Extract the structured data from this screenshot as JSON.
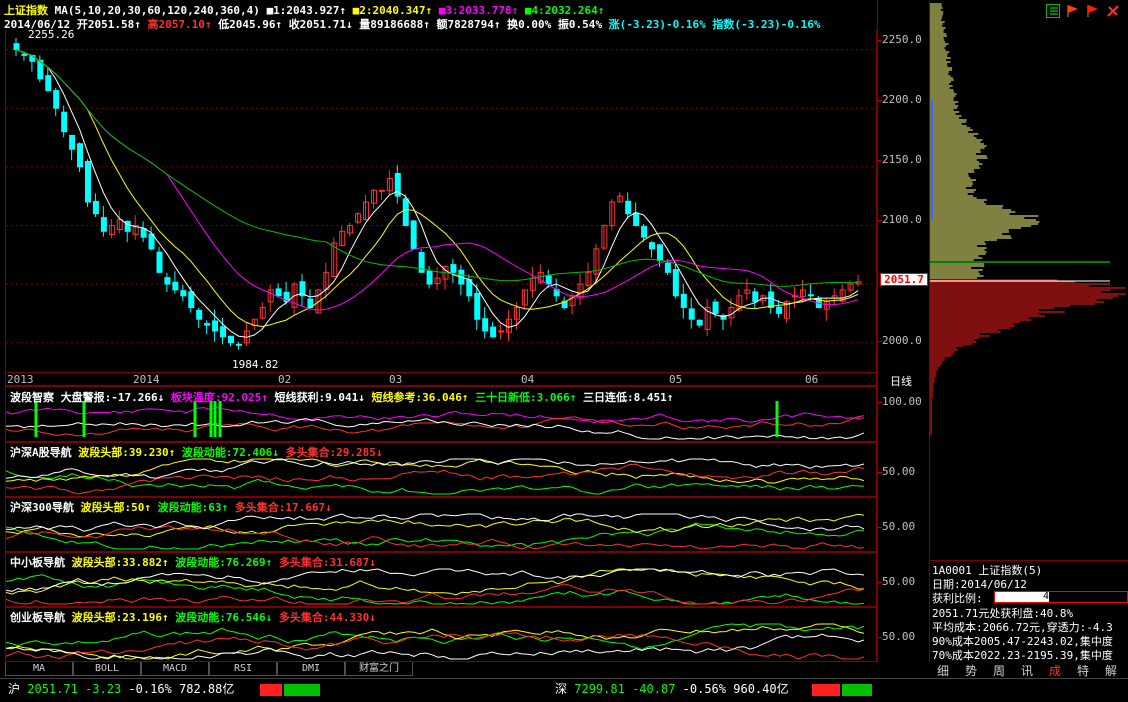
{
  "header": {
    "index_name": "上证指数",
    "ma_params": "MA(5,10,20,30,60,120,240,360,4)",
    "m1": "■1:2043.927↑",
    "m2": "■2:2040.347↑",
    "m3": "■3:2033.778↑",
    "m4": "■4:2032.264↑",
    "date": "2014/06/12",
    "open": "开2051.58↑",
    "high": "高2057.10↑",
    "low": "低2045.96↑",
    "close": "收2051.71↓",
    "volume": "量89186688↑",
    "amount": "额7828794↑",
    "turnover": "换0.00%",
    "amplitude": "振0.54%",
    "change": "涨(-3.23)-0.16%",
    "index_change": "指数(-3.23)-0.16%"
  },
  "toolbar_icons": [
    "grid-icon",
    "flag-icon",
    "flag-icon",
    "tools-icon"
  ],
  "main_chart": {
    "y_ticks": [
      "2250.0",
      "2200.0",
      "2150.0",
      "2100.0",
      "2050.0",
      "2000.0"
    ],
    "price_tag": "2051.7",
    "high_label": "2255.26",
    "low_label": "1984.82",
    "x_labels": [
      "2013",
      "2014",
      "02",
      "03",
      "04",
      "05",
      "06"
    ],
    "period": "日线"
  },
  "chart_data": {
    "type": "candlestick",
    "ylim": [
      1975,
      2265
    ],
    "values": [
      2250,
      2245,
      2240,
      2225,
      2215,
      2200,
      2180,
      2165,
      2150,
      2120,
      2110,
      2095,
      2100,
      2105,
      2095,
      2100,
      2090,
      2080,
      2060,
      2050,
      2045,
      2040,
      2030,
      2020,
      2015,
      2010,
      2005,
      2000,
      1998,
      2010,
      2020,
      2030,
      2045,
      2040,
      2035,
      2050,
      2040,
      2030,
      2045,
      2060,
      2085,
      2095,
      2100,
      2110,
      2120,
      2130,
      2130,
      2140,
      2125,
      2100,
      2080,
      2060,
      2050,
      2055,
      2065,
      2060,
      2050,
      2040,
      2020,
      2010,
      2005,
      2010,
      2020,
      2030,
      2045,
      2055,
      2060,
      2050,
      2040,
      2030,
      2040,
      2050,
      2060,
      2080,
      2100,
      2120,
      2125,
      2110,
      2100,
      2090,
      2080,
      2070,
      2060,
      2040,
      2030,
      2020,
      2015,
      2030,
      2025,
      2020,
      2030,
      2040,
      2045,
      2035,
      2040,
      2030,
      2025,
      2035,
      2040,
      2045,
      2040,
      2030,
      2035,
      2040,
      2045,
      2050,
      2052
    ]
  },
  "indicators": [
    {
      "title": "波段智察",
      "parts": [
        {
          "t": "大盘警报:-17.266↓",
          "c": "wht"
        },
        {
          "t": "板块温度:92.025↑",
          "c": "mag"
        },
        {
          "t": "短线获利:9.041↓",
          "c": "wht"
        },
        {
          "t": "短线参考:36.046↑",
          "c": "yel"
        },
        {
          "t": "三十日新低:3.066↑",
          "c": "grn"
        },
        {
          "t": "三日连低:8.451↑",
          "c": "wht"
        }
      ],
      "axis": "100.00"
    },
    {
      "title": "沪深A股导航",
      "parts": [
        {
          "t": "波段头部:39.230↑",
          "c": "yel"
        },
        {
          "t": "波段动能:72.406↓",
          "c": "grn"
        },
        {
          "t": "多头集合:29.285↓",
          "c": "red"
        }
      ],
      "axis": "50.00"
    },
    {
      "title": "沪深300导航",
      "parts": [
        {
          "t": "波段头部:50↑",
          "c": "yel"
        },
        {
          "t": "波段动能:63↑",
          "c": "grn"
        },
        {
          "t": "多头集合:17.667↓",
          "c": "red"
        }
      ],
      "axis": "50.00"
    },
    {
      "title": "中小板导航",
      "parts": [
        {
          "t": "波段头部:33.882↑",
          "c": "yel"
        },
        {
          "t": "波段动能:76.269↑",
          "c": "grn"
        },
        {
          "t": "多头集合:31.687↓",
          "c": "red"
        }
      ],
      "axis": "50.00"
    },
    {
      "title": "创业板导航",
      "parts": [
        {
          "t": "波段头部:23.196↑",
          "c": "yel"
        },
        {
          "t": "波段动能:76.546↓",
          "c": "grn"
        },
        {
          "t": "多头集合:44.330↓",
          "c": "red"
        }
      ],
      "axis": "50.00"
    }
  ],
  "tabs": [
    "MA",
    "BOLL",
    "MACD",
    "RSI",
    "DMI",
    "财富之门"
  ],
  "status_bar": {
    "sh_label": "沪",
    "sh_value": "2051.71",
    "sh_change": "-3.23",
    "sh_pct": "-0.16%",
    "sh_amount": "782.88亿",
    "sz_label": "深",
    "sz_value": "7299.81",
    "sz_change": "-40.87",
    "sz_pct": "-0.56%",
    "sz_amount": "960.40亿"
  },
  "side_panel": {
    "code_line": "1A0001 上证指数(5)",
    "date_line": "日期:2014/06/12",
    "profit_label": "获利比例:",
    "profit_value": "40.8%",
    "profit_ratio": 0.408,
    "line1": "2051.71元处获利盘:40.8%",
    "line2": "平均成本:2066.72元,穿透力:-4.3",
    "line3": "90%成本2005.47-2243.02,集中度",
    "line4": "70%成本2022.23-2195.39,集中度",
    "tabs": [
      "细",
      "势",
      "周",
      "讯",
      "成",
      "特",
      "解"
    ]
  },
  "colors": {
    "up": "#ff3232",
    "down": "#00ffff",
    "grid": "#800000",
    "yellow": "#ffff00"
  }
}
